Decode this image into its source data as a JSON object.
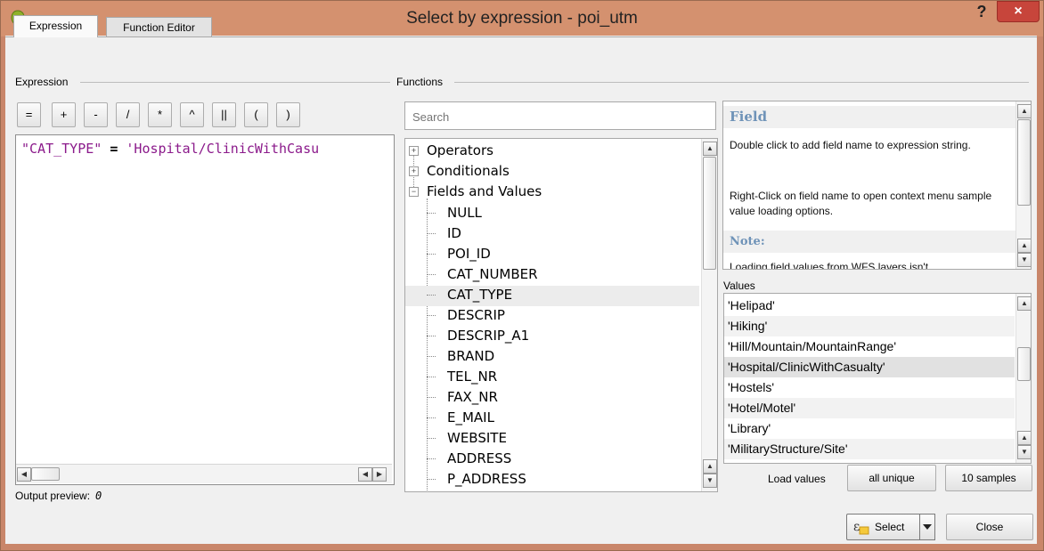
{
  "window": {
    "title": "Select by expression - poi_utm",
    "help_glyph": "?",
    "close_glyph": "×"
  },
  "tabs": [
    {
      "label": "Expression"
    },
    {
      "label": "Function Editor"
    }
  ],
  "expression_group": {
    "label": "Expression"
  },
  "functions_group": {
    "label": "Functions"
  },
  "operators": [
    "=",
    "+",
    "-",
    "/",
    "*",
    "^",
    "||",
    "(",
    ")"
  ],
  "expression": {
    "field": "\"CAT_TYPE\"",
    "op": " = ",
    "value": "'Hospital/ClinicWithCasu"
  },
  "output_preview": {
    "label": "Output preview:",
    "value": "0"
  },
  "search": {
    "placeholder": "Search"
  },
  "tree": {
    "groups": [
      {
        "label": "Operators",
        "expander": "+"
      },
      {
        "label": "Conditionals",
        "expander": "+"
      },
      {
        "label": "Fields and Values",
        "expander": "−"
      }
    ],
    "fields": [
      "NULL",
      "ID",
      "POI_ID",
      "CAT_NUMBER",
      "CAT_TYPE",
      "DESCRIP",
      "DESCRIP_A1",
      "BRAND",
      "TEL_NR",
      "FAX_NR",
      "E_MAIL",
      "WEBSITE",
      "ADDRESS",
      "P_ADDRESS"
    ],
    "selected": "CAT_TYPE"
  },
  "help": {
    "heading": "Field",
    "p1": "Double click to add field name to expression string.",
    "p2": "Right-Click on field name to open context menu sample value loading options.",
    "note_heading": "Note:",
    "note_text": "Loading field values from WFS layers isn't"
  },
  "values": {
    "label": "Values",
    "items": [
      "'Helipad'",
      "'Hiking'",
      "'Hill/Mountain/MountainRange'",
      "'Hospital/ClinicWithCasualty'",
      "'Hostels'",
      "'Hotel/Motel'",
      "'Library'",
      "'MilitaryStructure/Site'"
    ],
    "selected": "'Hospital/ClinicWithCasualty'"
  },
  "load_values": {
    "label": "Load values",
    "all_unique": "all unique",
    "samples": "10 samples"
  },
  "buttons": {
    "select": "Select",
    "close": "Close"
  },
  "colors": {
    "titlebar": "#d4916f",
    "close_button": "#c7453b",
    "help_heading": "#6f93b8",
    "expr_string": "#8b1a8b"
  }
}
